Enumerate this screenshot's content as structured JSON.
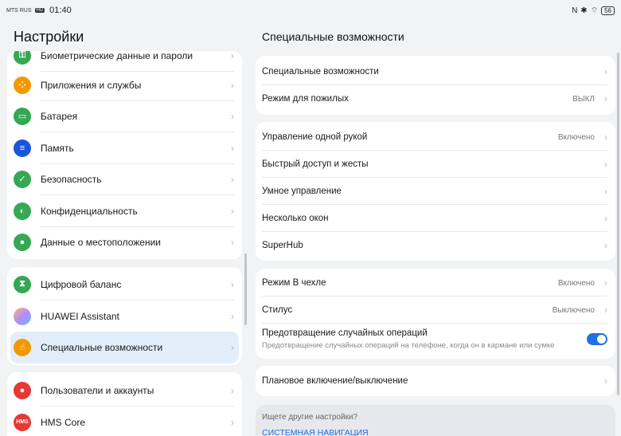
{
  "status_bar": {
    "carrier": "MTS RUS",
    "network": "HD",
    "time": "01:40",
    "icons": [
      "nfc-icon",
      "bluetooth-icon",
      "wifi-icon"
    ],
    "battery": "56"
  },
  "left": {
    "title": "Настройки",
    "group1": [
      {
        "label": "Биометрические данные и пароли",
        "icon": "key-icon",
        "color": "#34a853"
      },
      {
        "label": "Приложения и службы",
        "icon": "apps-icon",
        "color": "#f29900"
      },
      {
        "label": "Батарея",
        "icon": "battery-icon",
        "color": "#34a853"
      },
      {
        "label": "Память",
        "icon": "storage-icon",
        "color": "#1a56db"
      },
      {
        "label": "Безопасность",
        "icon": "shield-icon",
        "color": "#34a853"
      },
      {
        "label": "Конфиденциальность",
        "icon": "privacy-icon",
        "color": "#34a853"
      },
      {
        "label": "Данные о местоположении",
        "icon": "location-icon",
        "color": "#34a853"
      }
    ],
    "group2": [
      {
        "label": "Цифровой баланс",
        "icon": "hourglass-icon",
        "color": "#34a853"
      },
      {
        "label": "HUAWEI Assistant",
        "icon": "assistant-icon",
        "color": "#b48cff"
      },
      {
        "label": "Специальные возможности",
        "icon": "hand-icon",
        "color": "#f29900"
      }
    ],
    "group3": [
      {
        "label": "Пользователи и аккаунты",
        "icon": "user-icon",
        "color": "#e53935"
      },
      {
        "label": "HMS Core",
        "icon": "hms-icon",
        "color": "#e53935",
        "text": "HMS"
      }
    ]
  },
  "right": {
    "title": "Специальные возможности",
    "group1": [
      {
        "label": "Специальные возможности",
        "value": ""
      },
      {
        "label": "Режим для пожилых",
        "value": "ВЫКЛ"
      }
    ],
    "group2": [
      {
        "label": "Управление одной рукой",
        "value": "Включено"
      },
      {
        "label": "Быстрый доступ и жесты",
        "value": ""
      },
      {
        "label": "Умное управление",
        "value": ""
      },
      {
        "label": "Несколько окон",
        "value": ""
      },
      {
        "label": "SuperHub",
        "value": ""
      }
    ],
    "group3": [
      {
        "label": "Режим В чехле",
        "value": "Включено"
      },
      {
        "label": "Стилус",
        "value": "Выключено"
      }
    ],
    "accidental": {
      "label": "Предотвращение случайных операций",
      "sub": "Предотвращение случайных операций на телефоне, когда он в кармане или сумке",
      "toggle_on": true
    },
    "group4": [
      {
        "label": "Плановое включение/выключение",
        "value": ""
      }
    ],
    "hint": {
      "question": "Ищете другие настройки?",
      "link": "СИСТЕМНАЯ НАВИГАЦИЯ"
    }
  },
  "colors": {
    "accent": "#1f6fe5",
    "selected_bg": "#e3eefb"
  }
}
